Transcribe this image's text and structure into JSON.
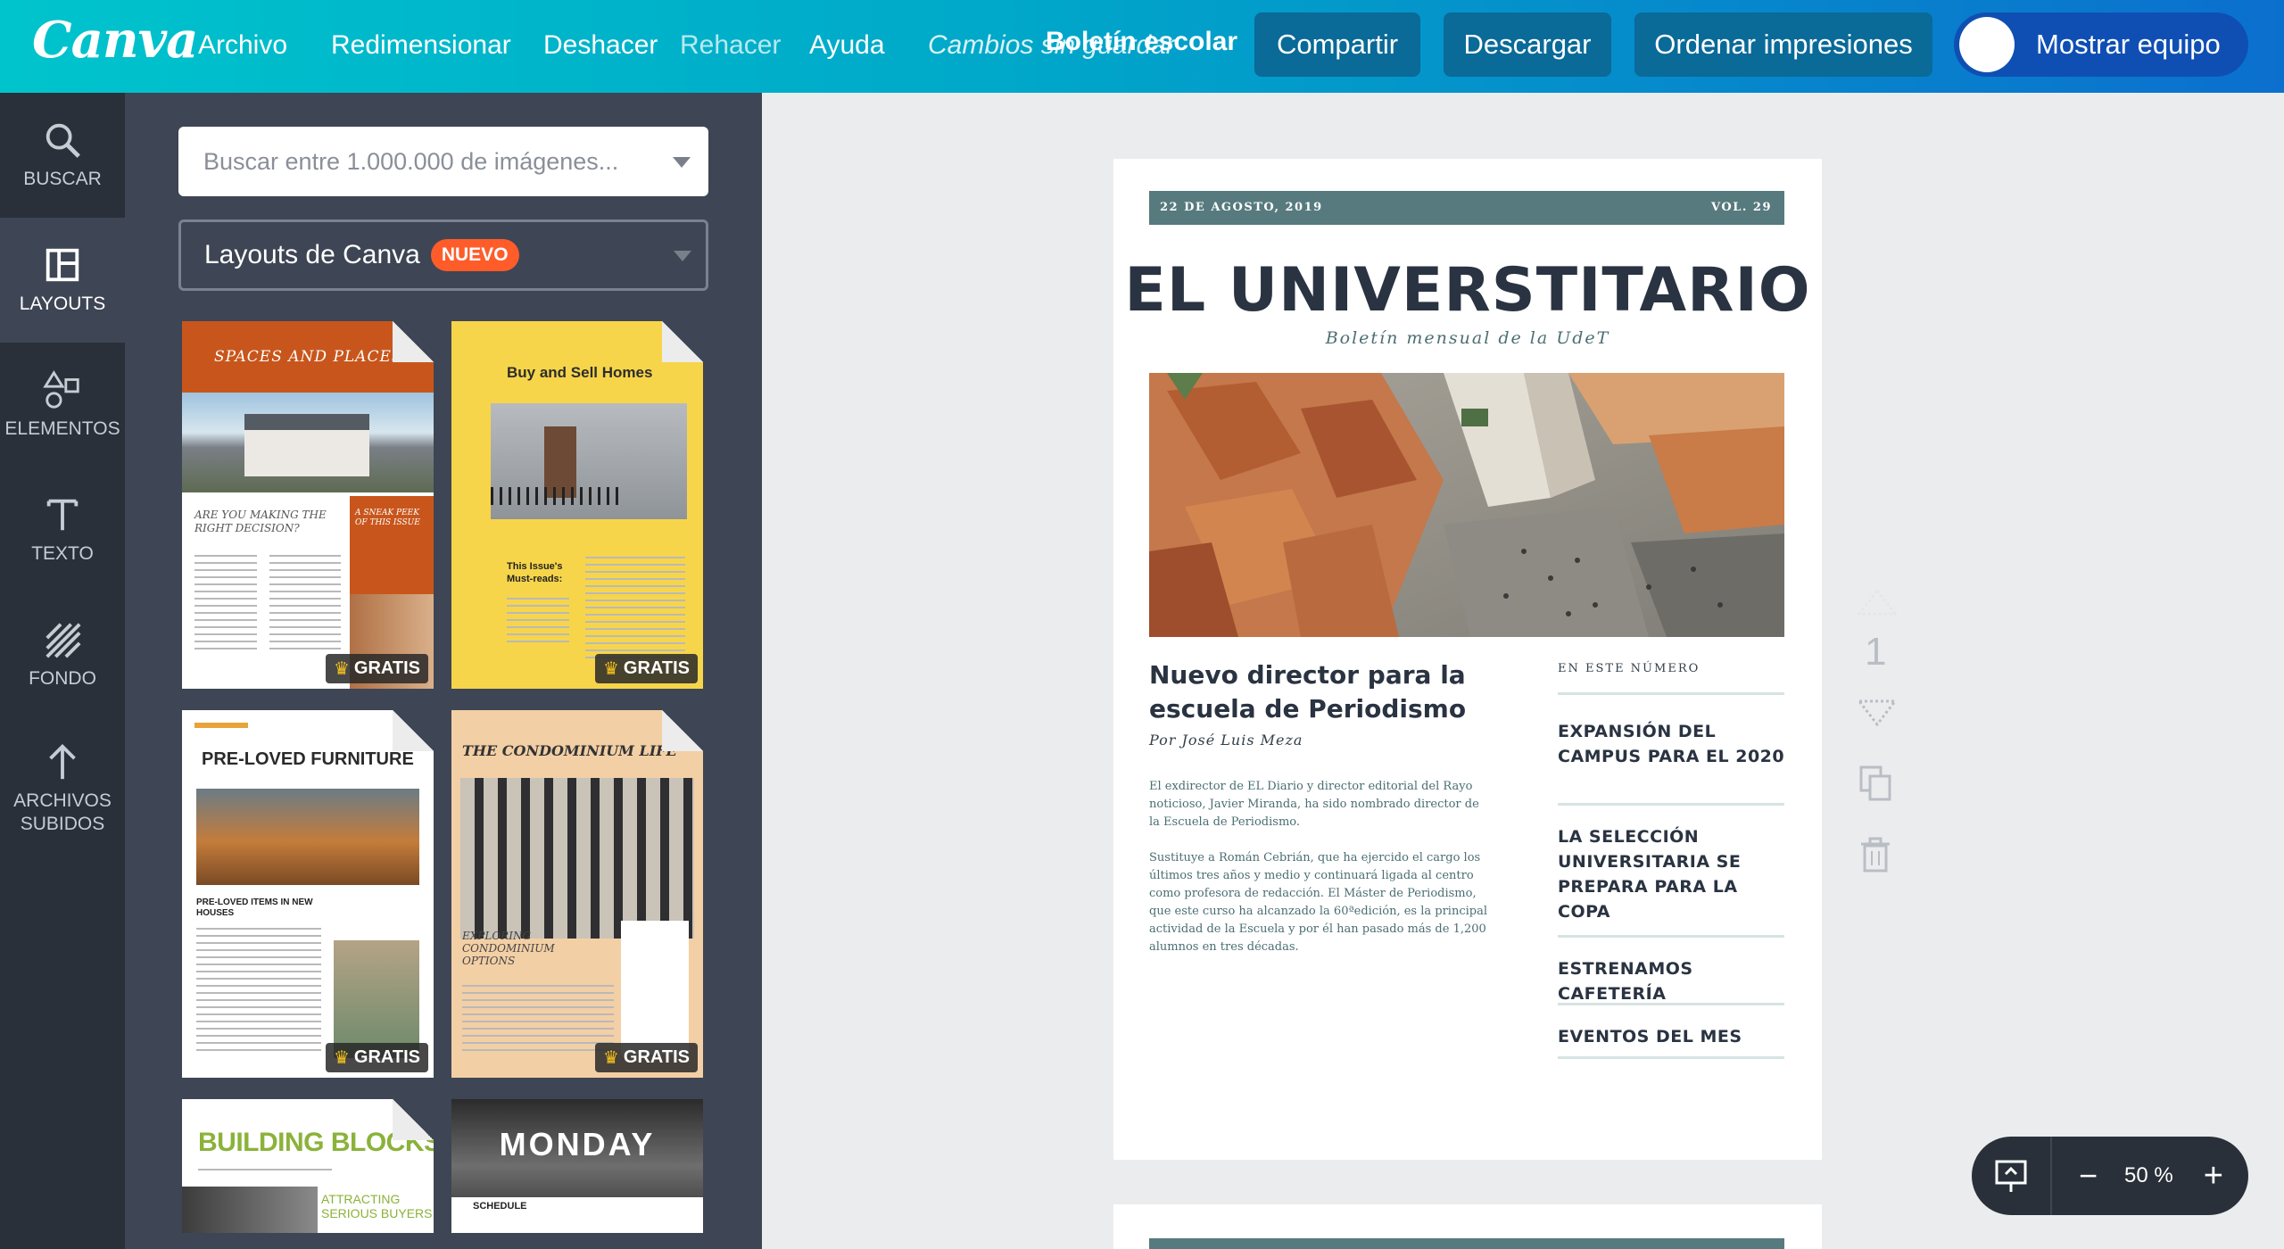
{
  "app": {
    "logo": "Canva",
    "menu": [
      "Archivo",
      "Redimensionar",
      "Deshacer",
      "Rehacer",
      "Ayuda"
    ],
    "status": "Cambios sin guardar",
    "document_title": "Boletín escolar",
    "buttons": {
      "share": "Compartir",
      "download": "Descargar",
      "order": "Ordenar impresiones",
      "team": "Mostrar equipo"
    }
  },
  "rail": [
    {
      "label": "BUSCAR",
      "icon": "search-icon"
    },
    {
      "label": "LAYOUTS",
      "icon": "layout-icon",
      "active": true
    },
    {
      "label": "ELEMENTOS",
      "icon": "shapes-icon"
    },
    {
      "label": "TEXTO",
      "icon": "text-icon"
    },
    {
      "label": "FONDO",
      "icon": "background-icon"
    },
    {
      "label": "ARCHIVOS\nSUBIDOS",
      "icon": "upload-icon"
    }
  ],
  "panel": {
    "search_placeholder": "Buscar entre 1.000.000 de imágenes...",
    "layouts_label": "Layouts de Canva",
    "new_badge": "NUEVO",
    "templates": [
      {
        "title": "SPACES AND PLACES",
        "subtitle": "ARE YOU MAKING THE RIGHT DECISION?",
        "side": "A SNEAK PEEK OF THIS ISSUE",
        "badge": "GRATIS"
      },
      {
        "title": "Buy and Sell Homes",
        "subtitle": "This Issue's Must-reads:",
        "badge": "GRATIS"
      },
      {
        "title": "PRE-LOVED FURNITURE",
        "subtitle": "PRE-LOVED ITEMS IN NEW HOUSES",
        "badge": "GRATIS"
      },
      {
        "title": "THE CONDOMINIUM LIFE",
        "subtitle": "EXPLORING CONDOMINIUM OPTIONS",
        "badge": "GRATIS"
      },
      {
        "title": "BUILDING BLOCKS",
        "subtitle": "ATTRACTING SERIOUS BUYERS"
      },
      {
        "title": "MONDAY",
        "subtitle": "SCHEDULE"
      }
    ]
  },
  "newsletter": {
    "date": "22 DE AGOSTO, 2019",
    "volume": "VOL. 29",
    "masthead": "EL UNIVERSTITARIO",
    "tagline": "Boletín mensual de la UdeT",
    "headline": "Nuevo director para la escuela de Periodismo",
    "byline": "Por José Luis Meza",
    "paragraphs": [
      "El exdirector de EL Diario y director editorial del Rayo noticioso, Javier Miranda, ha sido nombrado director de la Escuela de Periodismo.",
      "Sustituye a Román Cebrián, que ha ejercido el cargo los últimos tres años y medio y continuará ligada al centro como profesora de redacción. El Máster de Periodismo, que este curso ha alcanzado la 60ªedición, es la principal actividad de la Escuela y por él han pasado más de 1,200 alumnos en tres décadas."
    ],
    "toc_heading": "EN ESTE NÚMERO",
    "toc": [
      "EXPANSIÓN DEL CAMPUS PARA EL 2020",
      "LA SELECCIÓN UNIVERSITARIA SE PREPARA PARA LA COPA",
      "ESTRENAMOS CAFETERÍA",
      "EVENTOS DEL MES"
    ]
  },
  "page_tools": {
    "page_number": "1"
  },
  "zoom": {
    "level": "50 %",
    "minus": "−",
    "plus": "+"
  },
  "colors": {
    "accent": "#00c4cc",
    "brand_dark": "#0b6fce",
    "newsletter_teal": "#577a7e"
  }
}
